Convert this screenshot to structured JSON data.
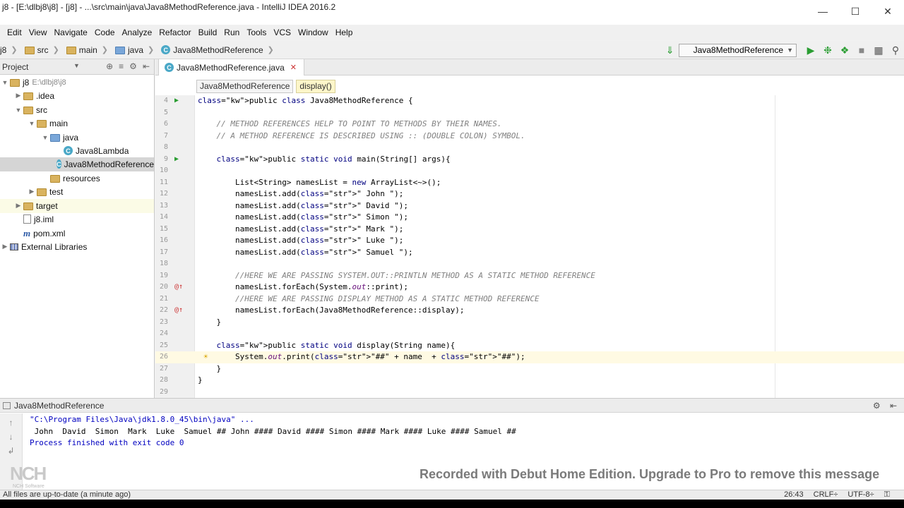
{
  "window": {
    "title": "j8 - [E:\\dlbj8\\j8] - [j8] - ...\\src\\main\\java\\Java8MethodReference.java - IntelliJ IDEA 2016.2"
  },
  "menu": [
    "Edit",
    "View",
    "Navigate",
    "Code",
    "Analyze",
    "Refactor",
    "Build",
    "Run",
    "Tools",
    "VCS",
    "Window",
    "Help"
  ],
  "navbar": {
    "crumbs": [
      "j8",
      "src",
      "main",
      "java",
      "Java8MethodReference"
    ],
    "run_config": "Java8MethodReference"
  },
  "project_panel": {
    "title": "Project",
    "tree": [
      {
        "label": "j8",
        "note": "E:\\dlbj8\\j8",
        "indent": 0,
        "arrow": "down",
        "icon": "folder"
      },
      {
        "label": ".idea",
        "indent": 1,
        "arrow": "right",
        "icon": "folder"
      },
      {
        "label": "src",
        "indent": 1,
        "arrow": "down",
        "icon": "folder"
      },
      {
        "label": "main",
        "indent": 2,
        "arrow": "down",
        "icon": "folder"
      },
      {
        "label": "java",
        "indent": 3,
        "arrow": "down",
        "icon": "folder-blue"
      },
      {
        "label": "Java8Lambda",
        "indent": 4,
        "arrow": "",
        "icon": "class"
      },
      {
        "label": "Java8MethodReference",
        "indent": 4,
        "arrow": "",
        "icon": "class",
        "selected": true
      },
      {
        "label": "resources",
        "indent": 3,
        "arrow": "",
        "icon": "folder"
      },
      {
        "label": "test",
        "indent": 2,
        "arrow": "right",
        "icon": "folder"
      },
      {
        "label": "target",
        "indent": 1,
        "arrow": "right",
        "icon": "folder",
        "highlight": true
      },
      {
        "label": "j8.iml",
        "indent": 1,
        "arrow": "",
        "icon": "file"
      },
      {
        "label": "pom.xml",
        "indent": 1,
        "arrow": "",
        "icon": "maven"
      },
      {
        "label": "External Libraries",
        "indent": 0,
        "arrow": "right",
        "icon": "library"
      }
    ]
  },
  "editor": {
    "tab_label": "Java8MethodReference.java",
    "breadcrumb_class": "Java8MethodReference",
    "breadcrumb_method": "display()",
    "lines": [
      {
        "n": "4",
        "code": "public class Java8MethodReference {",
        "mark": "run"
      },
      {
        "n": "5",
        "code": ""
      },
      {
        "n": "6",
        "code": "    // METHOD REFERENCES HELP TO POINT TO METHODS BY THEIR NAMES.",
        "kind": "comment"
      },
      {
        "n": "7",
        "code": "    // A METHOD REFERENCE IS DESCRIBED USING :: (DOUBLE COLON) SYMBOL.",
        "kind": "comment"
      },
      {
        "n": "8",
        "code": ""
      },
      {
        "n": "9",
        "code": "    public static void main(String[] args){",
        "mark": "run"
      },
      {
        "n": "10",
        "code": ""
      },
      {
        "n": "11",
        "code": "        List<String> namesList = new ArrayList<~>();"
      },
      {
        "n": "12",
        "code": "        namesList.add(\" John \");"
      },
      {
        "n": "13",
        "code": "        namesList.add(\" David \");"
      },
      {
        "n": "14",
        "code": "        namesList.add(\" Simon \");"
      },
      {
        "n": "15",
        "code": "        namesList.add(\" Mark \");"
      },
      {
        "n": "16",
        "code": "        namesList.add(\" Luke \");"
      },
      {
        "n": "17",
        "code": "        namesList.add(\" Samuel \");"
      },
      {
        "n": "18",
        "code": ""
      },
      {
        "n": "19",
        "code": "        //HERE WE ARE PASSING SYSTEM.OUT::PRINTLN METHOD AS A STATIC METHOD REFERENCE",
        "kind": "comment"
      },
      {
        "n": "20",
        "code": "        namesList.forEach(System.out::print);",
        "mark": "ovr"
      },
      {
        "n": "21",
        "code": "        //HERE WE ARE PASSING DISPLAY METHOD AS A STATIC METHOD REFERENCE",
        "kind": "comment"
      },
      {
        "n": "22",
        "code": "        namesList.forEach(Java8MethodReference::display);",
        "mark": "ovr"
      },
      {
        "n": "23",
        "code": "    }"
      },
      {
        "n": "24",
        "code": ""
      },
      {
        "n": "25",
        "code": "    public static void display(String name){"
      },
      {
        "n": "26",
        "code": "        System.out.print(\"##\" + name  + \"##\");",
        "current": true
      },
      {
        "n": "27",
        "code": "    }"
      },
      {
        "n": "28",
        "code": "}"
      },
      {
        "n": "29",
        "code": ""
      }
    ]
  },
  "run_panel": {
    "title": "Java8MethodReference",
    "command": "\"C:\\Program Files\\Java\\jdk1.8.0_45\\bin\\java\" ...",
    "output": " John  David  Simon  Mark  Luke  Samuel ## John #### David #### Simon #### Mark #### Luke #### Samuel ##",
    "exit": "Process finished with exit code 0",
    "watermark": "Recorded with Debut Home Edition. Upgrade to Pro to remove this message",
    "logo_text": "NCH",
    "logo_sub": "NCH Software"
  },
  "statusbar": {
    "message": "All files are up-to-date (a minute ago)",
    "position": "26:43",
    "line_sep": "CRLF÷",
    "encoding": "UTF-8÷"
  }
}
